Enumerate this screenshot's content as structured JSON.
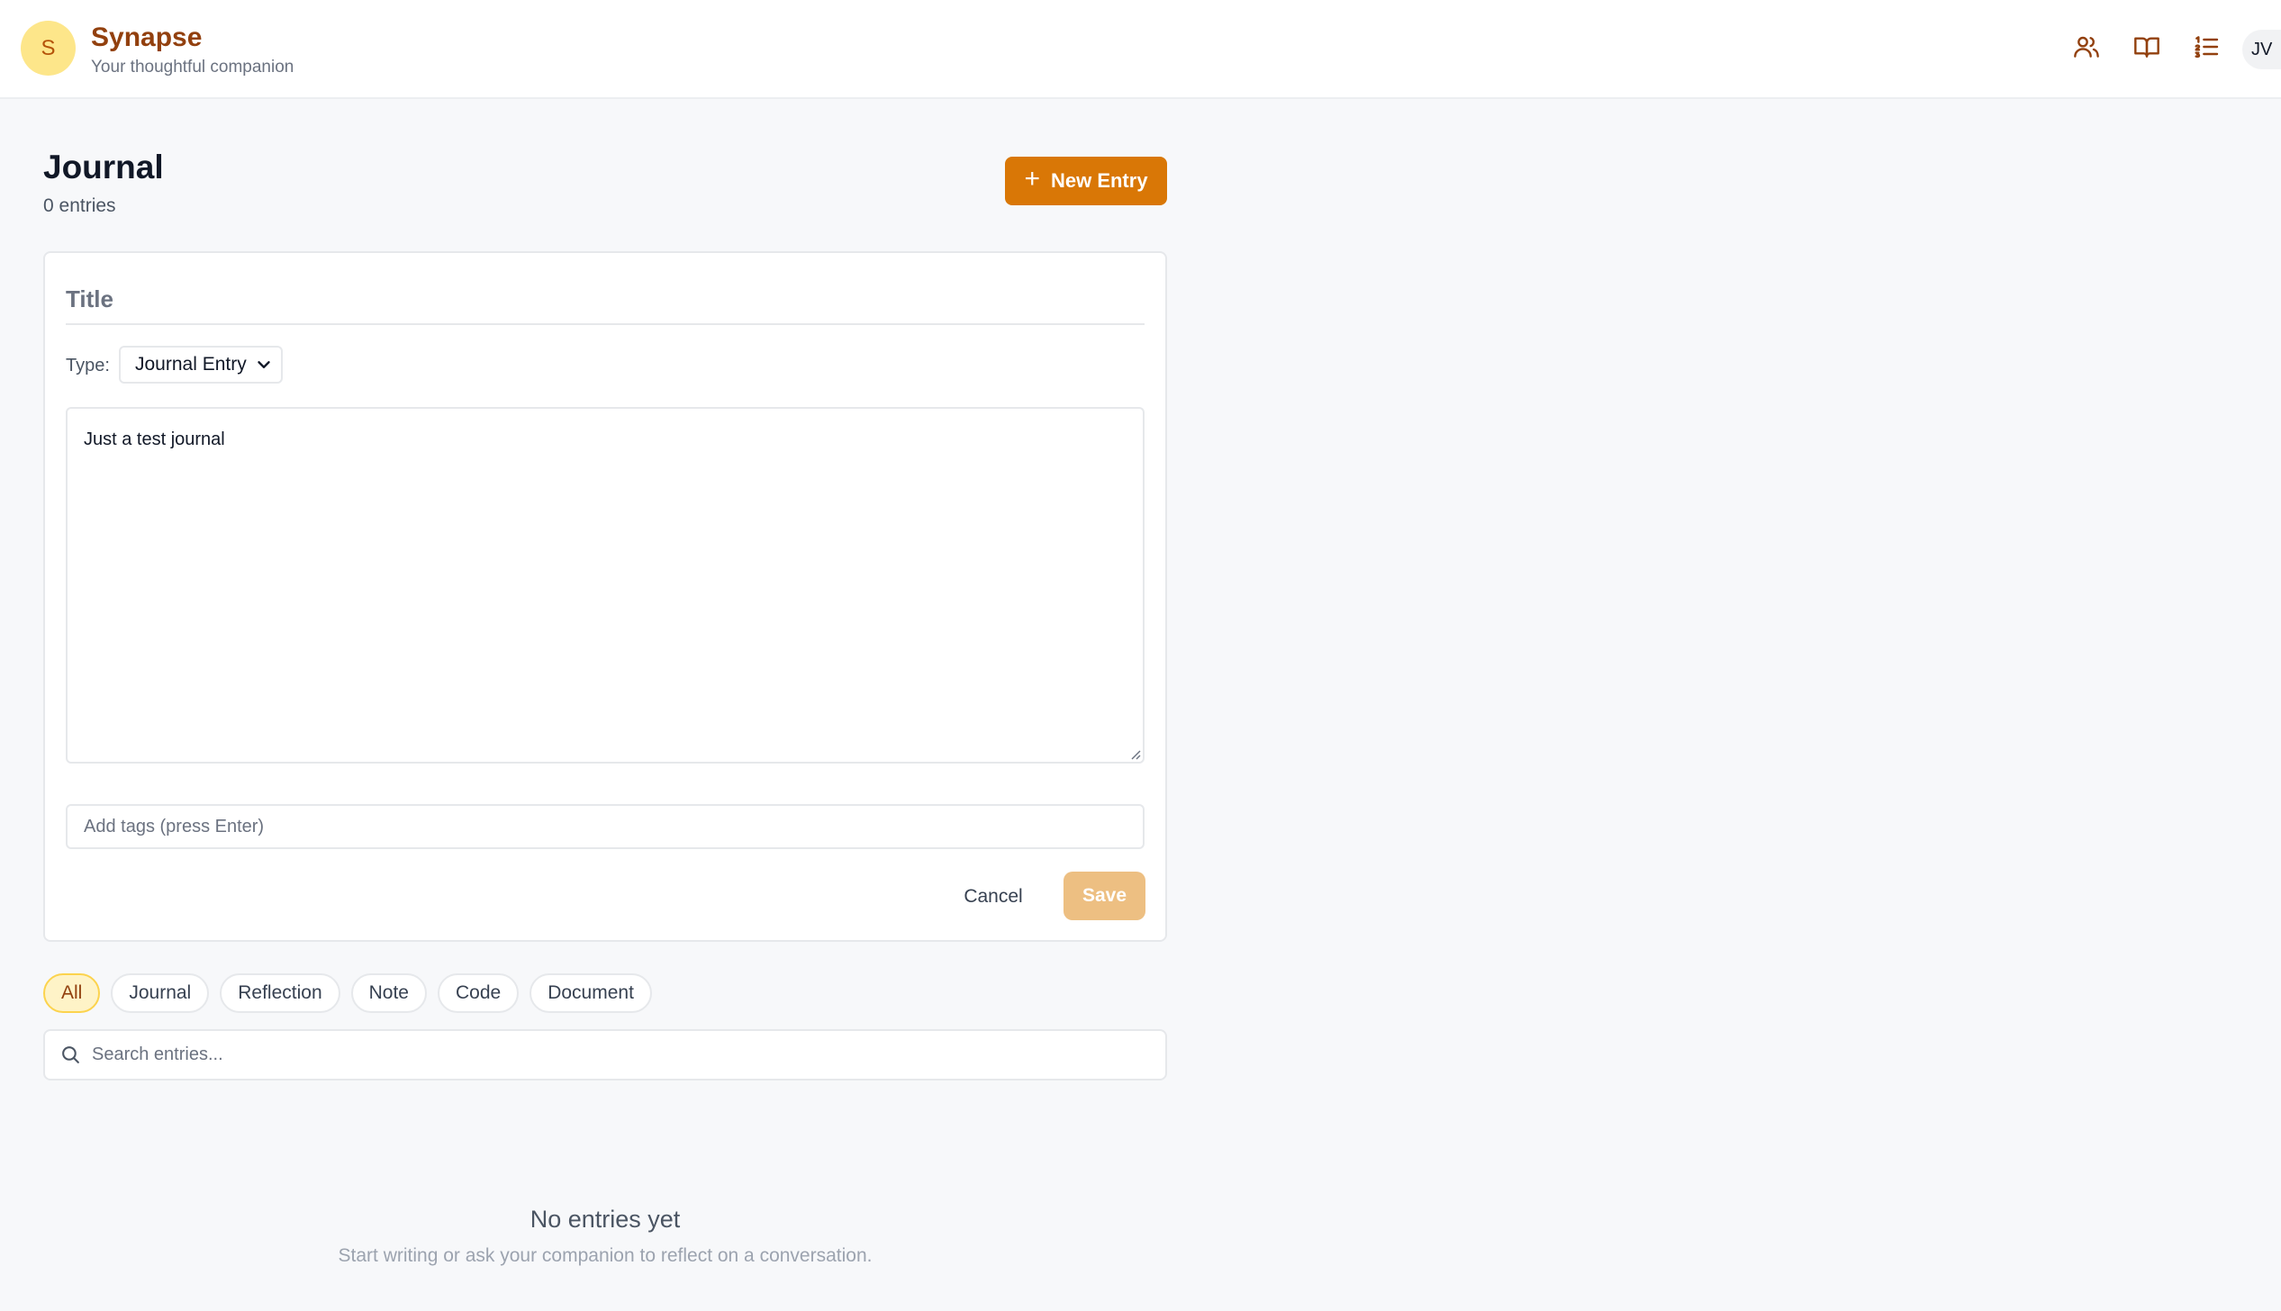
{
  "header": {
    "logo_letter": "S",
    "app_title": "Synapse",
    "app_subtitle": "Your thoughtful companion",
    "icons": [
      "users-icon",
      "book-open-icon",
      "list-ordered-icon"
    ],
    "user_initials": "JV",
    "accent_color": "#92400e"
  },
  "page": {
    "title": "Journal",
    "entry_count": "0 entries",
    "new_entry_label": "New Entry"
  },
  "editor": {
    "title_placeholder": "Title",
    "title_value": "",
    "type_label": "Type:",
    "type_selected": "Journal Entry",
    "body_value": "Just a test journal",
    "tags_placeholder": "Add tags (press Enter)",
    "cancel_label": "Cancel",
    "save_label": "Save",
    "primary_color": "#d97706",
    "save_disabled_color": "#edbf82"
  },
  "filters": {
    "chips": [
      "All",
      "Journal",
      "Reflection",
      "Note",
      "Code",
      "Document"
    ],
    "active": "All"
  },
  "search": {
    "placeholder": "Search entries..."
  },
  "empty_state": {
    "title": "No entries yet",
    "subtitle": "Start writing or ask your companion to reflect on a conversation."
  }
}
